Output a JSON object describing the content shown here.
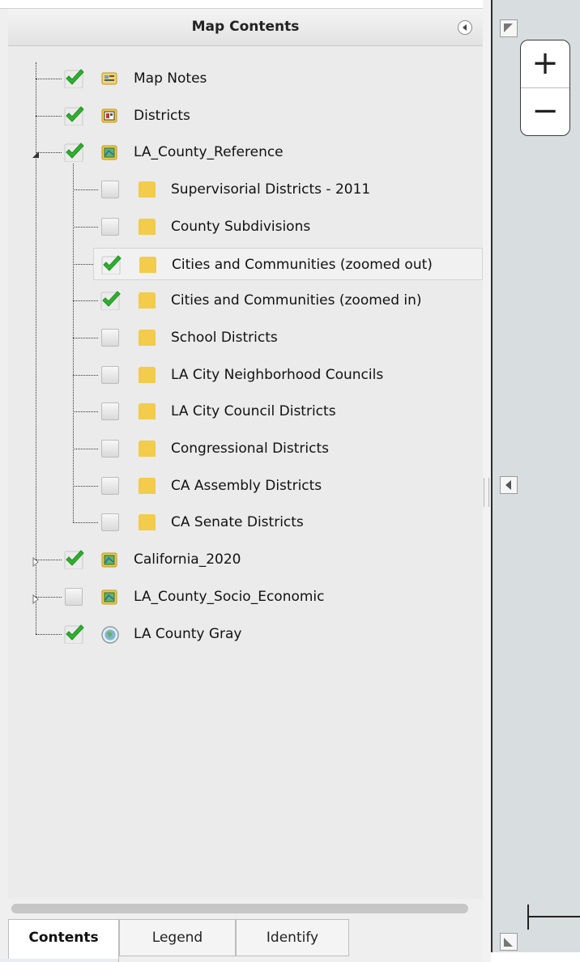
{
  "panel": {
    "title": "Map Contents"
  },
  "tree": [
    {
      "label": "Map Notes",
      "checked": true,
      "icon": "map-notes-icon",
      "level": 0
    },
    {
      "label": "Districts",
      "checked": true,
      "icon": "feature-layer-icon",
      "level": 0
    },
    {
      "label": "LA_County_Reference",
      "checked": true,
      "icon": "map-service-icon",
      "level": 0,
      "expanded": true
    },
    {
      "label": "Supervisorial Districts - 2011",
      "checked": false,
      "icon": "folder-icon",
      "level": 1
    },
    {
      "label": "County Subdivisions",
      "checked": false,
      "icon": "folder-icon",
      "level": 1
    },
    {
      "label": "Cities and Communities (zoomed out)",
      "checked": true,
      "icon": "folder-icon",
      "level": 1,
      "selected": true
    },
    {
      "label": "Cities and Communities (zoomed in)",
      "checked": true,
      "icon": "folder-icon",
      "level": 1
    },
    {
      "label": "School Districts",
      "checked": false,
      "icon": "folder-icon",
      "level": 1
    },
    {
      "label": "LA City Neighborhood Councils",
      "checked": false,
      "icon": "folder-icon",
      "level": 1
    },
    {
      "label": "LA City Council Districts",
      "checked": false,
      "icon": "folder-icon",
      "level": 1
    },
    {
      "label": "Congressional Districts",
      "checked": false,
      "icon": "folder-icon",
      "level": 1
    },
    {
      "label": "CA Assembly Districts",
      "checked": false,
      "icon": "folder-icon",
      "level": 1
    },
    {
      "label": "CA Senate Districts",
      "checked": false,
      "icon": "folder-icon",
      "level": 1
    },
    {
      "label": "California_2020",
      "checked": true,
      "icon": "map-service-icon",
      "level": 0,
      "expanded": false
    },
    {
      "label": "LA_County_Socio_Economic",
      "checked": false,
      "icon": "map-service-icon",
      "level": 0,
      "expanded": false
    },
    {
      "label": "LA County Gray",
      "checked": true,
      "icon": "basemap-globe-icon",
      "level": 0
    }
  ],
  "tabs": [
    {
      "label": "Contents",
      "active": true
    },
    {
      "label": "Legend",
      "active": false
    },
    {
      "label": "Identify",
      "active": false
    }
  ],
  "map": {
    "zoom_in": "+",
    "zoom_out": "−"
  },
  "colors": {
    "check_green": "#2fb12f",
    "folder_yellow": "#f2cc4a",
    "panel_bg": "#ebebeb",
    "map_bg": "#d8dde0"
  }
}
